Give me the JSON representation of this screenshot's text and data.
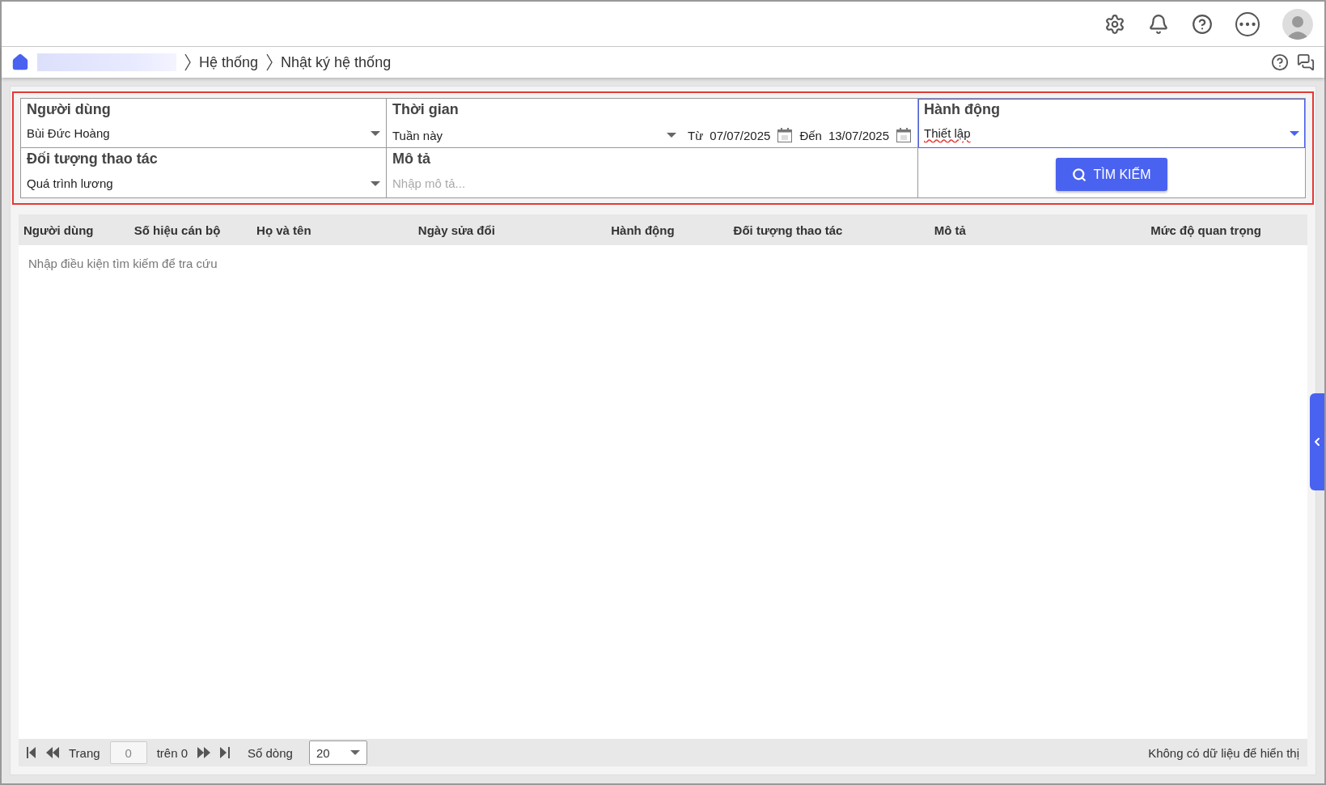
{
  "breadcrumb": [
    "Hệ thống",
    "Nhật ký hệ thống"
  ],
  "filters": {
    "user": {
      "label": "Người dùng",
      "value": "Bùi Đức Hoàng"
    },
    "time": {
      "label": "Thời gian",
      "value": "Tuần này",
      "from_label": "Từ",
      "from": "07/07/2025",
      "to_label": "Đến",
      "to": "13/07/2025"
    },
    "action": {
      "label": "Hành động",
      "value": "Thiết lập",
      "focused": true
    },
    "object": {
      "label": "Đối tượng thao tác",
      "value": "Quá trình lương"
    },
    "description": {
      "label": "Mô tả",
      "placeholder": "Nhập mô tả..."
    },
    "search_button": "TÌM KIẾM"
  },
  "table": {
    "columns": [
      "Người dùng",
      "Số hiệu cán bộ",
      "Họ và tên",
      "Ngày sửa đổi",
      "Hành động",
      "Đối tượng thao tác",
      "Mô tả",
      "Mức độ quan trọng"
    ],
    "empty_message": "Nhập điều kiện tìm kiếm để tra cứu"
  },
  "pager": {
    "page_label": "Trang",
    "page": "0",
    "of": "trên 0",
    "rows_label": "Số dòng",
    "rows": "20",
    "status": "Không có dữ liệu để hiển thị"
  }
}
